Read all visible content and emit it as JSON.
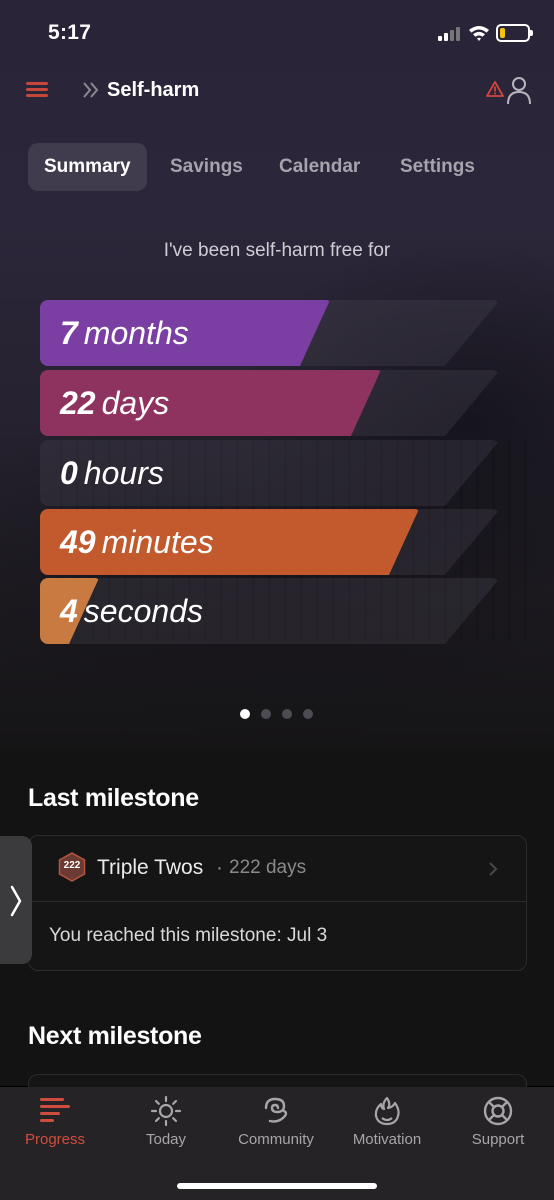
{
  "status_bar": {
    "time": "5:17"
  },
  "header": {
    "title": "Self-harm"
  },
  "tabs": [
    {
      "label": "Summary",
      "active": true
    },
    {
      "label": "Savings",
      "active": false
    },
    {
      "label": "Calendar",
      "active": false
    },
    {
      "label": "Settings",
      "active": false
    }
  ],
  "summary": {
    "intro": "I've been self-harm free for",
    "counters": [
      {
        "value": "7",
        "unit": "months",
        "progress": 0.62,
        "color": "#7b3fa3"
      },
      {
        "value": "22",
        "unit": "days",
        "progress": 0.74,
        "color": "#8e3260"
      },
      {
        "value": "0",
        "unit": "hours",
        "progress": 0.0,
        "color": "#6a6870"
      },
      {
        "value": "49",
        "unit": "minutes",
        "progress": 0.83,
        "color": "#c25a2e"
      },
      {
        "value": "4",
        "unit": "seconds",
        "progress": 0.07,
        "color": "#c87a40"
      }
    ],
    "page_count": 4,
    "active_page": 1
  },
  "last_milestone": {
    "heading": "Last milestone",
    "badge": "222",
    "name": "Triple Twos",
    "separator": "·",
    "days": "222 days",
    "reached": "You reached this milestone: Jul 3"
  },
  "next_milestone": {
    "heading": "Next milestone"
  },
  "bottom_nav": [
    {
      "label": "Progress",
      "icon": "progress-icon",
      "active": true
    },
    {
      "label": "Today",
      "icon": "sun-icon",
      "active": false
    },
    {
      "label": "Community",
      "icon": "community-icon",
      "active": false
    },
    {
      "label": "Motivation",
      "icon": "flame-icon",
      "active": false
    },
    {
      "label": "Support",
      "icon": "lifebuoy-icon",
      "active": false
    }
  ],
  "colors": {
    "accent": "#cf4d3e",
    "months": "#7b3fa3",
    "days": "#8e3260",
    "minutes": "#c25a2e",
    "seconds": "#c87a40"
  }
}
